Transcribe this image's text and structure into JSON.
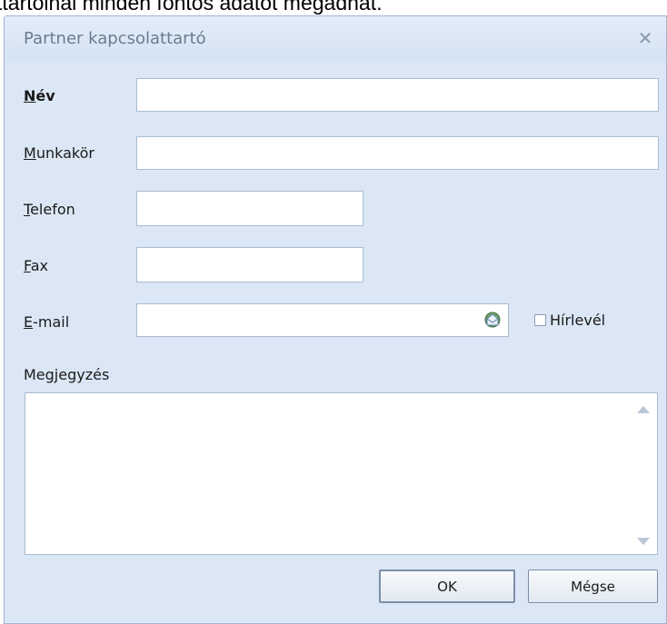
{
  "background_caption": "ttartóinál minden fontos adatot megadhat.",
  "dialog": {
    "title": "Partner kapcsolattartó",
    "close_glyph": "✕"
  },
  "form": {
    "name": {
      "access_key": "N",
      "label_rest": "év",
      "value": ""
    },
    "position": {
      "access_key": "M",
      "label_rest": "unkakör",
      "value": ""
    },
    "phone": {
      "access_key": "T",
      "label_rest": "elefon",
      "value": ""
    },
    "fax": {
      "access_key": "F",
      "label_rest": "ax",
      "value": ""
    },
    "email": {
      "access_key": "E",
      "label_rest": "-mail",
      "value": "",
      "icon": "email-open-icon"
    },
    "newsletter": {
      "label": "Hírlevél",
      "checked": false
    },
    "notes": {
      "label": "Megjegyzés",
      "value": ""
    }
  },
  "buttons": {
    "ok": "OK",
    "cancel": "Mégse"
  }
}
